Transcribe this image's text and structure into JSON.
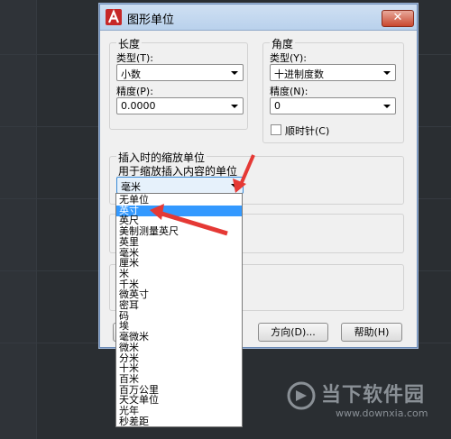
{
  "dialog": {
    "title": "图形单位",
    "close_label": "✕"
  },
  "length": {
    "group_label": "长度",
    "type_label": "类型(T):",
    "type_value": "小数",
    "precision_label": "精度(P):",
    "precision_value": "0.0000"
  },
  "angle": {
    "group_label": "角度",
    "type_label": "类型(Y):",
    "type_value": "十进制度数",
    "precision_label": "精度(N):",
    "precision_value": "0",
    "clockwise_label": "顺时针(C)"
  },
  "insert": {
    "group_label": "插入时的缩放单位",
    "desc_label": "用于缩放插入内容的单位",
    "value": "毫米"
  },
  "dropdown_options": [
    "无单位",
    "英寸",
    "英尺",
    "美制测量英尺",
    "英里",
    "毫米",
    "厘米",
    "米",
    "千米",
    "微英寸",
    "密耳",
    "码",
    "埃",
    "毫微米",
    "微米",
    "分米",
    "十米",
    "百米",
    "百万公里",
    "天文单位",
    "光年",
    "秒差距"
  ],
  "dropdown_selected": "英寸",
  "buttons": {
    "direction": "方向(D)...",
    "help": "帮助(H)"
  },
  "colors": {
    "annotation_arrow": "#e53935",
    "selection": "#3399ff"
  },
  "watermark": {
    "name": "当下软件园",
    "url": "www.downxia.com"
  }
}
